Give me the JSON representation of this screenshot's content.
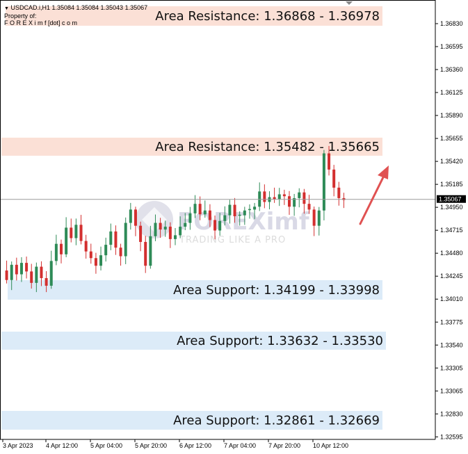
{
  "header": {
    "symbol_line": "USDCAD.i,H1  1.35084 1.35084 1.35043 1.35067",
    "property_label": "Property of:",
    "owner": "F O R E X i m f [dot] c o m"
  },
  "watermark": {
    "brand": "FOREXimf",
    "tagline": "TRADING LIKE A PRO",
    "logo_icon": "foreximf-logo-icon"
  },
  "colors": {
    "bull": "#2e8b57",
    "bear": "#d32f2f",
    "resistance_zone": "#fbe0d6",
    "support_zone": "#dcebf8",
    "arrow": "#e05252",
    "price_line": "#9a9a9a",
    "price_tag": "#000000"
  },
  "chart_data": {
    "type": "candlestick",
    "symbol": "USDCAD.i",
    "timeframe": "H1",
    "ylim": [
      1.3255,
      1.3705
    ],
    "y_ticks": [
      "1.36830",
      "1.36595",
      "1.36360",
      "1.36125",
      "1.35890",
      "1.35655",
      "1.35420",
      "1.35185",
      "1.34950",
      "1.34715",
      "1.34480",
      "1.34245",
      "1.34010",
      "1.33775",
      "1.33540",
      "1.33305",
      "1.33065",
      "1.32830",
      "1.32595"
    ],
    "x_ticks": [
      "3 Apr 2023",
      "4 Apr 12:00",
      "5 Apr 04:00",
      "5 Apr 20:00",
      "6 Apr 12:00",
      "7 Apr 04:00",
      "7 Apr 20:00",
      "10 Apr 12:00"
    ],
    "current_price": "1.35067",
    "zones": [
      {
        "kind": "resistance",
        "label": "Area Resistance: 1.36868 - 1.36978",
        "high": 1.36978,
        "low": 1.36868
      },
      {
        "kind": "resistance",
        "label": "Area Resistance: 1.35482 - 1.35665",
        "high": 1.35665,
        "low": 1.35482
      },
      {
        "kind": "support",
        "label": "Area Support: 1.34199 - 1.33998",
        "high": 1.34199,
        "low": 1.33998
      },
      {
        "kind": "support",
        "label": "Area Support: 1.33632 - 1.33530",
        "high": 1.33632,
        "low": 1.3353
      },
      {
        "kind": "support",
        "label": "Area Support: 1.32861 - 1.32669",
        "high": 1.32861,
        "low": 1.32669
      }
    ],
    "arrow_direction": "up",
    "path": [
      1.3432,
      1.3422,
      1.3438,
      1.3428,
      1.344,
      1.3431,
      1.3419,
      1.3436,
      1.3424,
      1.3416,
      1.3442,
      1.346,
      1.3449,
      1.3477,
      1.3466,
      1.348,
      1.3463,
      1.3452,
      1.3445,
      1.3437,
      1.3448,
      1.3459,
      1.3473,
      1.3456,
      1.3447,
      1.3482,
      1.3496,
      1.3479,
      1.3462,
      1.3437,
      1.3468,
      1.3482,
      1.3475,
      1.3478,
      1.3465,
      1.3469,
      1.3478,
      1.3482,
      1.3492,
      1.3502,
      1.3491,
      1.3495,
      1.3485,
      1.3474,
      1.3484,
      1.349,
      1.3501,
      1.3489,
      1.349,
      1.3495,
      1.3496,
      1.3499,
      1.3515,
      1.3504,
      1.3509,
      1.3507,
      1.3512,
      1.351,
      1.3499,
      1.3508,
      1.3514,
      1.3502,
      1.3496,
      1.3479,
      1.3495,
      1.3555,
      1.3538,
      1.3519,
      1.3508,
      1.3506
    ]
  }
}
